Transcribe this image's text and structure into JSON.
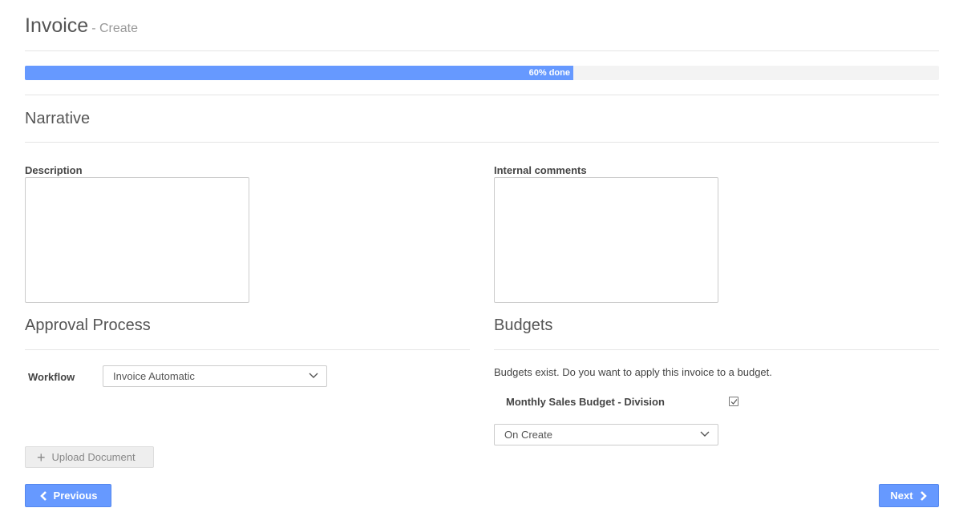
{
  "header": {
    "title": "Invoice",
    "subtitle": "- Create"
  },
  "progress": {
    "percent": 60,
    "label": "60% done"
  },
  "narrative": {
    "title": "Narrative",
    "description_label": "Description",
    "description_value": "",
    "internal_comments_label": "Internal comments",
    "internal_comments_value": ""
  },
  "approval": {
    "title": "Approval Process",
    "workflow_label": "Workflow",
    "workflow_value": "Invoice Automatic"
  },
  "budgets": {
    "title": "Budgets",
    "note": "Budgets exist. Do you want to apply this invoice to a budget.",
    "budget_name": "Monthly Sales Budget - Division",
    "budget_checked": true,
    "timing_value": "On Create"
  },
  "actions": {
    "upload_label": "Upload Document",
    "previous_label": "Previous",
    "next_label": "Next"
  },
  "icons": {
    "upload": "plus-icon",
    "previous": "chevron-left-icon",
    "next": "chevron-right-icon",
    "select": "chevron-down-icon",
    "checkbox": "checkmark-icon"
  },
  "colors": {
    "accent": "#6699ff",
    "progress_track": "#f3f3f3"
  }
}
